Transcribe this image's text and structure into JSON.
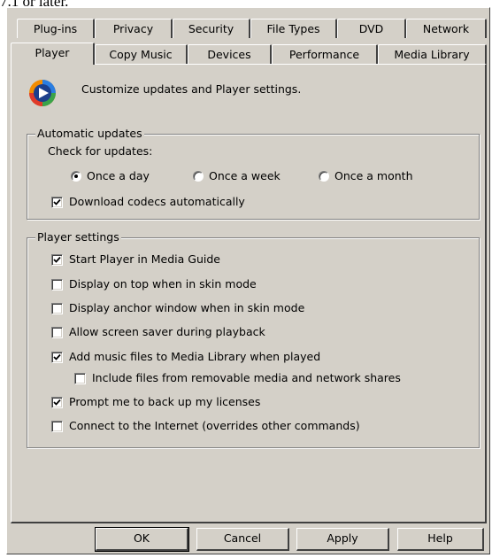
{
  "caption": "7.1 or later.",
  "tabs_back": [
    "Plug-ins",
    "Privacy",
    "Security",
    "File Types",
    "DVD",
    "Network"
  ],
  "tabs_front": [
    "Player",
    "Copy Music",
    "Devices",
    "Performance",
    "Media Library"
  ],
  "active_tab": "Player",
  "intro": "Customize updates and Player settings.",
  "automatic_updates": {
    "legend": "Automatic updates",
    "check_label": "Check for updates:",
    "options": [
      "Once a day",
      "Once a week",
      "Once a month"
    ],
    "selected": "Once a day",
    "download_codecs": {
      "label": "Download codecs automatically",
      "checked": true
    }
  },
  "player_settings": {
    "legend": "Player settings",
    "items": [
      {
        "label": "Start Player in Media Guide",
        "checked": true
      },
      {
        "label": "Display on top when in skin mode",
        "checked": false
      },
      {
        "label": "Display anchor window when in skin mode",
        "checked": false
      },
      {
        "label": "Allow screen saver during playback",
        "checked": false
      },
      {
        "label": "Add music files to Media Library when played",
        "checked": true
      },
      {
        "label": "Include files from removable media and network shares",
        "checked": false
      },
      {
        "label": "Prompt me to back up my licenses",
        "checked": true
      },
      {
        "label": "Connect to the Internet (overrides other commands)",
        "checked": false
      }
    ]
  },
  "buttons": {
    "ok": "OK",
    "cancel": "Cancel",
    "apply": "Apply",
    "help": "Help"
  },
  "colors": {
    "face": "#d4d0c8",
    "highlight": "#ffffff",
    "shadow": "#808080",
    "dark_shadow": "#404040"
  }
}
